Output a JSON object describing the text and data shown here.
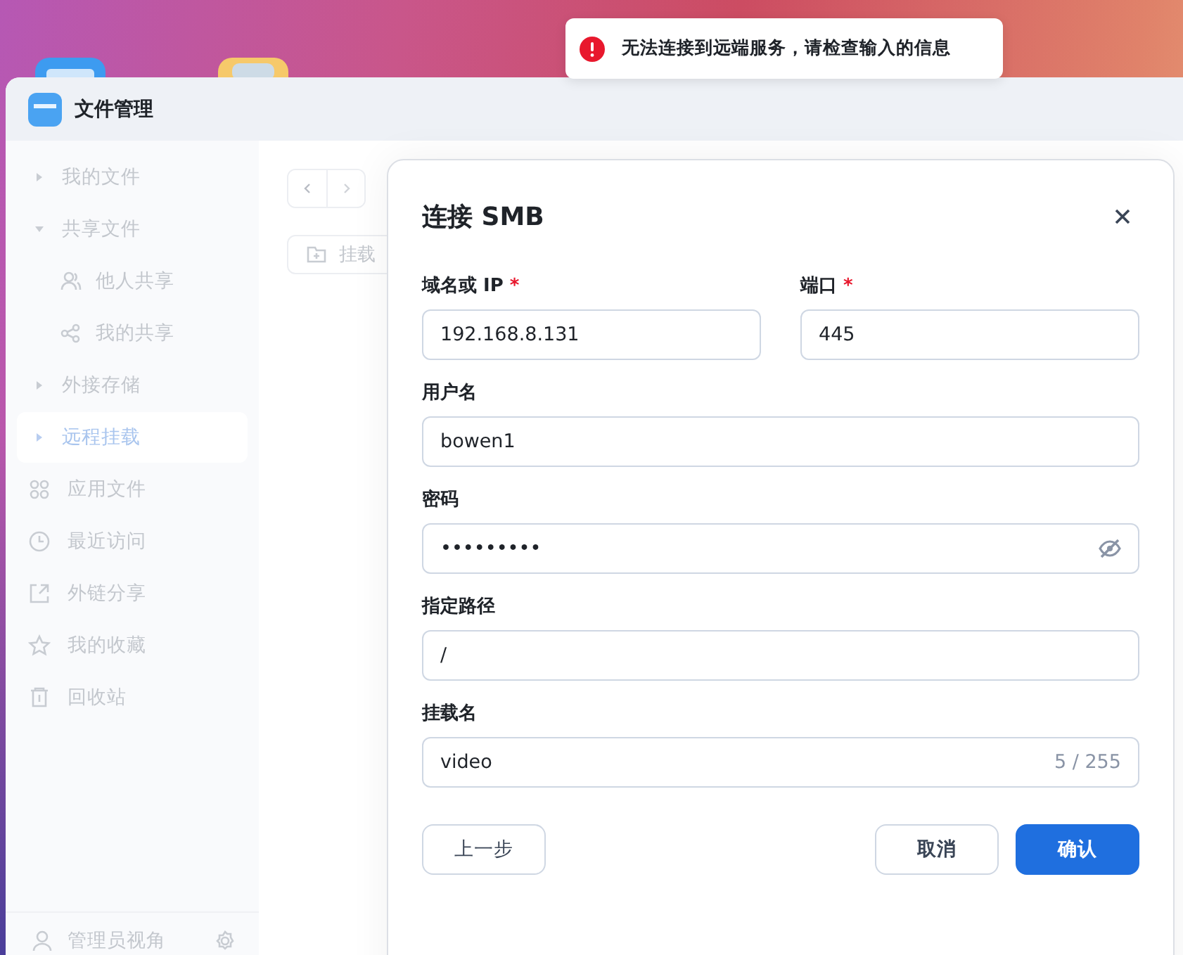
{
  "toast": {
    "message": "无法连接到远端服务，请检查输入的信息"
  },
  "window": {
    "title": "文件管理"
  },
  "sidebar": {
    "items": [
      {
        "label": "我的文件",
        "kind": "group",
        "expanded": false,
        "selected": false
      },
      {
        "label": "共享文件",
        "kind": "group",
        "expanded": true,
        "selected": false,
        "children": [
          {
            "label": "他人共享",
            "kind": "people",
            "selected": false
          },
          {
            "label": "我的共享",
            "kind": "share",
            "selected": false
          }
        ]
      },
      {
        "label": "外接存储",
        "kind": "group",
        "expanded": false,
        "selected": false
      },
      {
        "label": "远程挂载",
        "kind": "group",
        "expanded": false,
        "selected": true
      },
      {
        "label": "应用文件",
        "kind": "apps",
        "selected": false
      },
      {
        "label": "最近访问",
        "kind": "recent",
        "selected": false
      },
      {
        "label": "外链分享",
        "kind": "link",
        "selected": false
      },
      {
        "label": "我的收藏",
        "kind": "star",
        "selected": false
      },
      {
        "label": "回收站",
        "kind": "trash",
        "selected": false
      }
    ],
    "footer": {
      "label": "管理员视角"
    }
  },
  "toolbar": {
    "mount_button": "挂载"
  },
  "dialog": {
    "title": "连接 SMB",
    "rows": [
      [
        {
          "label": "域名或 IP",
          "required_mark": "*",
          "value": "192.168.8.131"
        },
        {
          "label": "端口",
          "required_mark": "*",
          "value": "445"
        }
      ],
      [
        {
          "label": "用户名",
          "value": "bowen1"
        }
      ],
      [
        {
          "label": "密码",
          "kind": "password",
          "value": "•••••••••"
        }
      ],
      [
        {
          "label": "指定路径",
          "value": "/"
        }
      ],
      [
        {
          "label": "挂载名",
          "value": "video",
          "counter": "5 / 255"
        }
      ]
    ],
    "buttons": [
      {
        "label": "上一步",
        "kind": "back"
      },
      {
        "label": "取消",
        "kind": "secondary"
      },
      {
        "label": "确认",
        "kind": "primary"
      }
    ]
  }
}
